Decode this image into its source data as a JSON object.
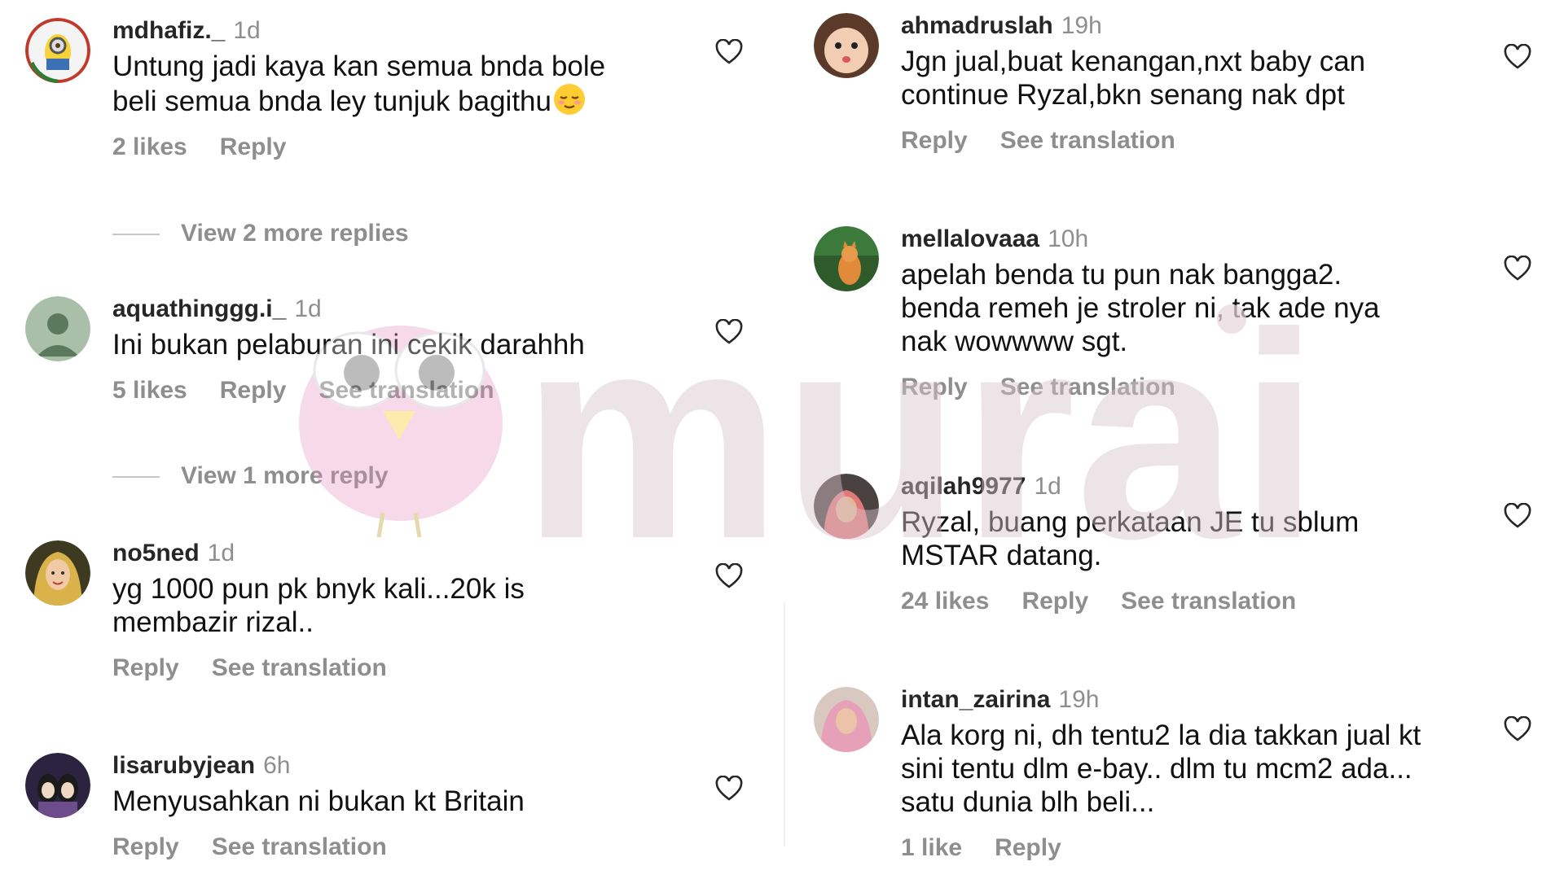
{
  "watermark_text": "murai",
  "actions": {
    "reply": "Reply",
    "see_translation": "See translation"
  },
  "left_comments": [
    {
      "username": "mdhafiz._",
      "time": "1d",
      "text": "Untung jadi kaya kan semua bnda bole\nbeli semua bnda ley tunjuk bagithu",
      "emoji": "relieved-face-emoji",
      "likes": "2 likes"
    },
    {
      "username": "aquathinggg.i_",
      "time": "1d",
      "text": "Ini bukan pelaburan ini cekik darahhh",
      "likes": "5 likes"
    },
    {
      "username": "no5ned",
      "time": "1d",
      "text": "yg 1000 pun pk bnyk kali...20k is\nmembazir rizal.."
    },
    {
      "username": "lisarubyjean",
      "time": "6h",
      "text": "Menyusahkan ni bukan kt Britain"
    }
  ],
  "view_more": [
    "View 2 more replies",
    "View 1 more reply"
  ],
  "right_comments": [
    {
      "username": "ahmadruslah",
      "time": "19h",
      "text": "Jgn jual,buat kenangan,nxt baby can\ncontinue Ryzal,bkn senang nak dpt"
    },
    {
      "username": "mellalovaaa",
      "time": "10h",
      "text": "apelah benda tu pun nak bangga2.\nbenda remeh je stroler ni, tak ade nya\nnak wowwww sgt."
    },
    {
      "username": "aqilah9977",
      "time": "1d",
      "text": "Ryzal, buang perkataan JE tu sblum\nMSTAR datang.",
      "likes": "24 likes"
    },
    {
      "username": "intan_zairina",
      "time": "19h",
      "text": "Ala korg ni, dh tentu2 la dia takkan jual kt\nsini tentu dlm e-bay.. dlm tu mcm2 ada...\nsatu dunia blh beli...",
      "likes": "1 like"
    }
  ]
}
